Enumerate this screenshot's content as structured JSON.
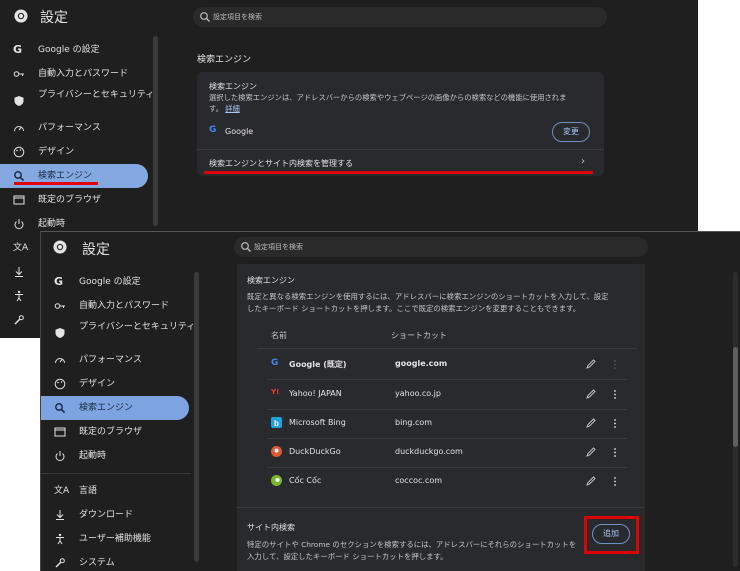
{
  "app": {
    "title": "設定",
    "search_placeholder": "設定項目を検索"
  },
  "sidebar": {
    "items": [
      {
        "label": "Google の設定"
      },
      {
        "label": "自動入力とパスワード"
      },
      {
        "label": "プライバシーとセキュリティ"
      },
      {
        "label": "パフォーマンス"
      },
      {
        "label": "デザイン"
      },
      {
        "label": "検索エンジン"
      },
      {
        "label": "既定のブラウザ"
      },
      {
        "label": "起動時"
      },
      {
        "label": "言語"
      },
      {
        "label": "ダウンロード"
      },
      {
        "label": "ユーザー補助機能"
      },
      {
        "label": "システム"
      }
    ]
  },
  "top": {
    "section_title": "検索エンジン",
    "card_title": "検索エンジン",
    "card_desc": "選択した検索エンジンは、アドレスバーからの検索やウェブページの画像からの検索などの機能に使用されま",
    "card_desc2": "す。",
    "details_link": "詳細",
    "engine_name": "Google",
    "change_button": "変更",
    "manage_label": "検索エンジンとサイト内検索を管理する"
  },
  "bottom": {
    "heading": "検索エンジン",
    "desc1": "既定と異なる検索エンジンを使用するには、アドレスバーに検索エンジンのショートカットを入力して、設定",
    "desc2": "したキーボード ショートカットを押します。ここで既定の検索エンジンを変更することもできます。",
    "col_name": "名前",
    "col_shortcut": "ショートカット",
    "engines": [
      {
        "name": "Google (既定)",
        "shortcut": "google.com",
        "icon": "google-g-icon",
        "bold": true
      },
      {
        "name": "Yahoo! JAPAN",
        "shortcut": "yahoo.co.jp",
        "icon": "yahoo-icon",
        "bold": false
      },
      {
        "name": "Microsoft Bing",
        "shortcut": "bing.com",
        "icon": "bing-icon",
        "bold": false
      },
      {
        "name": "DuckDuckGo",
        "shortcut": "duckduckgo.com",
        "icon": "duckduckgo-icon",
        "bold": false
      },
      {
        "name": "Cốc Cốc",
        "shortcut": "coccoc.com",
        "icon": "coccoc-icon",
        "bold": false
      }
    ],
    "site_search_heading": "サイト内検索",
    "site_desc1": "特定のサイトや Chrome のセクションを検索するには、アドレスバーにそれらのショートカットを",
    "site_desc2": "入力して、設定したキーボード ショートカットを押します。",
    "add_button": "追加"
  },
  "colors": {
    "background": "#1f1f1f",
    "card": "#292a2d",
    "selected": "#7da4e0",
    "highlight": "#e00000"
  }
}
